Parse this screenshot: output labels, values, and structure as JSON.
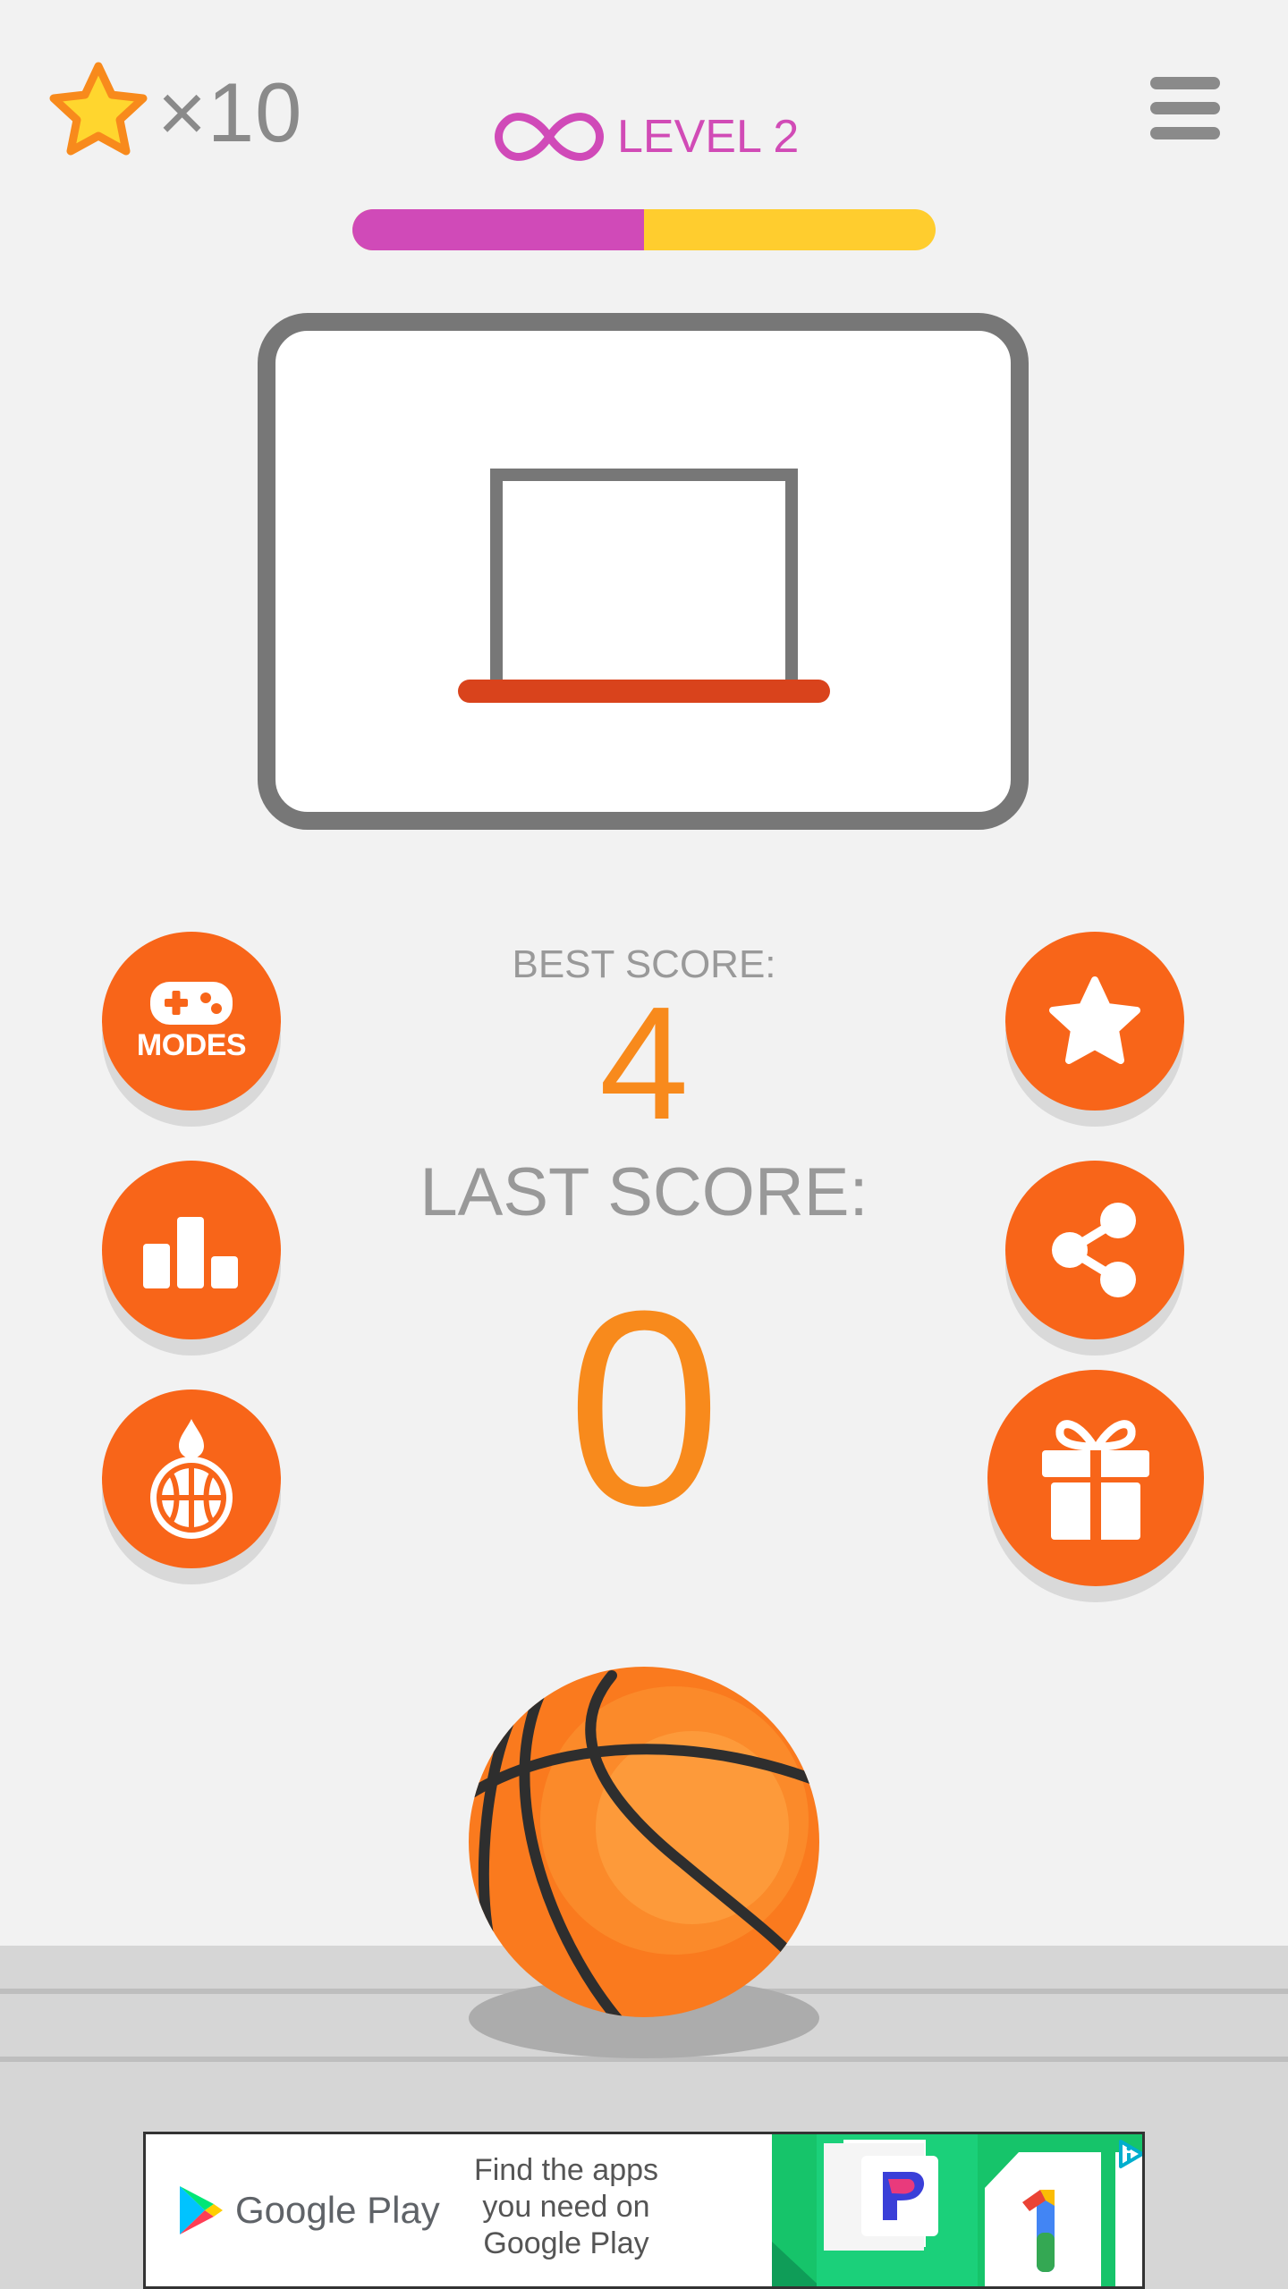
{
  "hud": {
    "stars_count": "×10",
    "star_icon": "star-icon",
    "level_icon": "infinity-icon",
    "level_label": "LEVEL 2",
    "level_progress": 0.5,
    "menu_icon": "hamburger-menu-icon"
  },
  "scores": {
    "best_label": "BEST SCORE:",
    "best_value": "4",
    "last_label": "LAST SCORE:",
    "last_value": "0"
  },
  "buttons": {
    "modes_label": "MODES",
    "modes_icon": "gamepad-icon",
    "leaderboard_icon": "podium-icon",
    "ball_skins_icon": "ball-drop-icon",
    "rate_icon": "star-icon",
    "share_icon": "share-icon",
    "gift_icon": "gift-icon"
  },
  "ad": {
    "brand": "Google Play",
    "text": "Find the apps you need on Google Play",
    "adchoices_icon": "adchoices-icon"
  },
  "colors": {
    "accent_orange": "#f86519",
    "score_orange": "#f88a1c",
    "level_magenta": "#d04ab8",
    "progress_yellow": "#ffcd2e",
    "rim_red": "#d9431c",
    "background": "#f2f2f2"
  }
}
